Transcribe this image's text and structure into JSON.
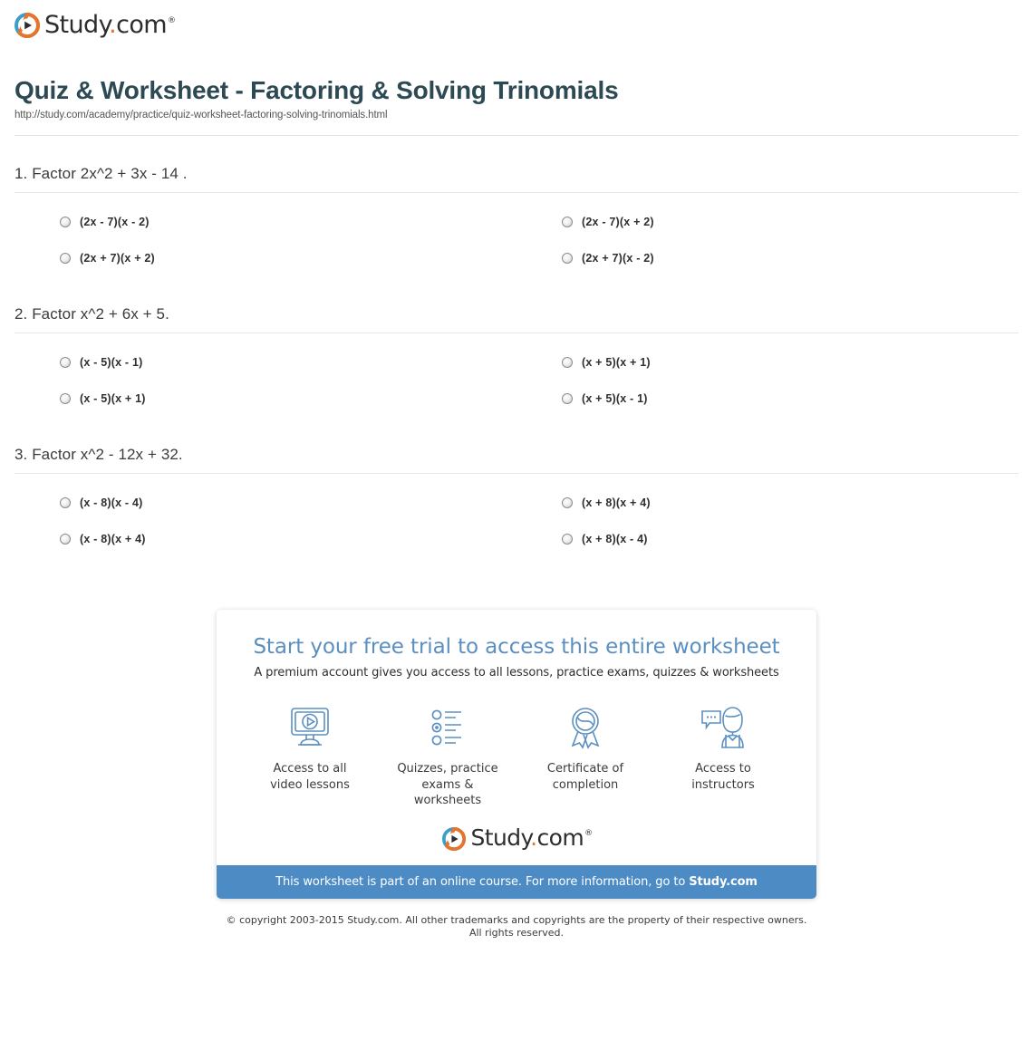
{
  "brand": {
    "name_main": "Study",
    "name_dot": ".",
    "name_tld": "com",
    "trademark": "®",
    "logo_icon": "study-play-circle-icon",
    "colors": {
      "orange": "#e8732a",
      "blue": "#3d9ec9",
      "dark": "#2d2d2d"
    }
  },
  "header": {
    "title": "Quiz & Worksheet - Factoring & Solving Trinomials",
    "url": "http://study.com/academy/practice/quiz-worksheet-factoring-solving-trinomials.html",
    "title_color": "#2d4a54"
  },
  "questions": [
    {
      "text": "1. Factor 2x^2 + 3x - 14 .",
      "options": [
        "(2x - 7)(x - 2)",
        "(2x - 7)(x + 2)",
        "(2x + 7)(x + 2)",
        "(2x + 7)(x - 2)"
      ]
    },
    {
      "text": "2. Factor x^2 + 6x + 5.",
      "options": [
        "(x - 5)(x - 1)",
        "(x + 5)(x + 1)",
        "(x - 5)(x + 1)",
        "(x + 5)(x - 1)"
      ]
    },
    {
      "text": "3. Factor x^2 - 12x + 32.",
      "options": [
        "(x - 8)(x - 4)",
        "(x + 8)(x + 4)",
        "(x - 8)(x + 4)",
        "(x + 8)(x - 4)"
      ]
    }
  ],
  "promo": {
    "title": "Start your free trial to access this entire worksheet",
    "subtitle": "A premium account gives you access to all lessons, practice exams, quizzes & worksheets",
    "title_color": "#5b8fc0",
    "features": [
      {
        "icon": "monitor-play-icon",
        "line1": "Access to all",
        "line2": "video lessons"
      },
      {
        "icon": "checklist-icon",
        "line1": "Quizzes, practice",
        "line2": "exams & worksheets"
      },
      {
        "icon": "award-ribbon-icon",
        "line1": "Certificate of",
        "line2": "completion"
      },
      {
        "icon": "instructor-chat-icon",
        "line1": "Access to",
        "line2": "instructors"
      }
    ],
    "bar_text": "This worksheet is part of an online course. For more information, go to ",
    "bar_link": "Study.com",
    "bar_color": "#4d8bc4"
  },
  "footer": {
    "line1": "© copyright 2003-2015 Study.com. All other trademarks and copyrights are the property of their respective owners.",
    "line2": "All rights reserved."
  }
}
